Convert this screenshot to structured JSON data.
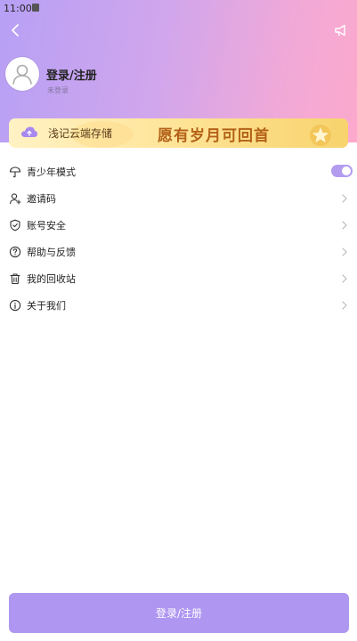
{
  "status_bar": {
    "time": "11:00"
  },
  "header": {
    "back_icon": "chevron-left-icon",
    "notice_icon": "megaphone-icon",
    "user_name": "登录/注册",
    "user_subtitle": "未登录"
  },
  "banner": {
    "left_text": "浅记云端存储",
    "right_text": "愿有岁月可回首",
    "cloud_icon": "cloud-upload-icon"
  },
  "menu": [
    {
      "label": "青少年模式",
      "icon": "umbrella-icon",
      "type": "toggle",
      "enabled": true
    },
    {
      "label": "邀请码",
      "icon": "user-add-icon",
      "type": "link"
    },
    {
      "label": "账号安全",
      "icon": "shield-icon",
      "type": "link"
    },
    {
      "label": "帮助与反馈",
      "icon": "help-icon",
      "type": "link"
    },
    {
      "label": "我的回收站",
      "icon": "trash-icon",
      "type": "link"
    },
    {
      "label": "关于我们",
      "icon": "info-icon",
      "type": "link"
    }
  ],
  "login_button": {
    "label": "登录/注册"
  },
  "colors": {
    "accent": "#ae96f1",
    "toggle_on": "#b39cf0",
    "header_gradient_start": "#b7a0f5",
    "header_gradient_end": "#fca9cc"
  }
}
